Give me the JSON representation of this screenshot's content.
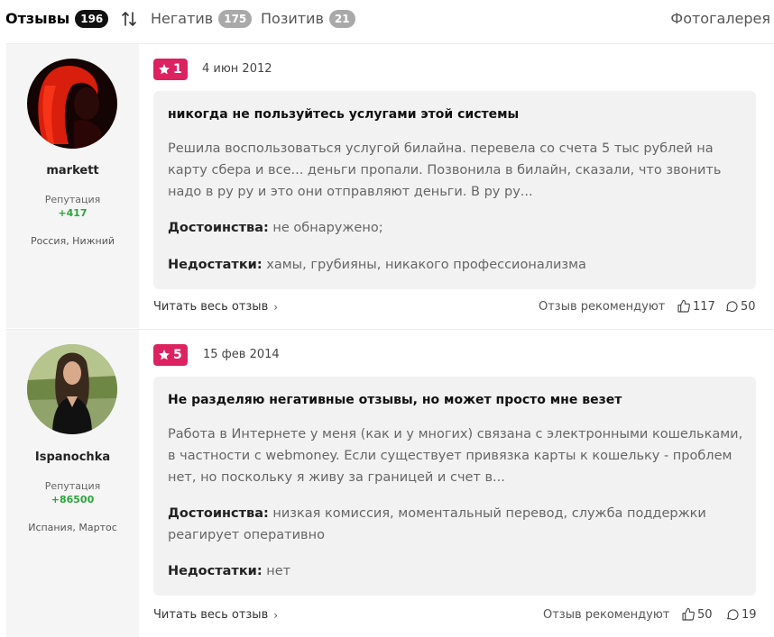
{
  "tabs": {
    "reviews": {
      "label": "Отзывы",
      "count": "196"
    },
    "negative": {
      "label": "Негатив",
      "count": "175"
    },
    "positive": {
      "label": "Позитив",
      "count": "21"
    },
    "gallery": {
      "label": "Фотогалерея"
    }
  },
  "reviews": [
    {
      "author": {
        "name": "markett",
        "reputation_label": "Репутация",
        "reputation": "+417",
        "location": "Россия, Нижний"
      },
      "rating": "1",
      "date": "4 июн 2012",
      "title": "никогда не пользуйтесь услугами этой системы",
      "text": "Решила воспользоваться услугой билайна. перевела со счета 5 тыс рублей на карту сбера и все... деньги пропали. Позвонила в билайн, сказали, что звонить надо в ру ру и это они отправляют деньги. В ру ру...",
      "pros_label": "Достоинства:",
      "pros": "не обнаружено;",
      "cons_label": "Недостатки:",
      "cons": "хамы, грубияны, никакого профессионализма",
      "read_more": "Читать весь отзыв",
      "recommend": "Отзыв рекомендуют",
      "likes": "117",
      "comments": "50"
    },
    {
      "author": {
        "name": "Ispanochka",
        "reputation_label": "Репутация",
        "reputation": "+86500",
        "location": "Испания, Мартос"
      },
      "rating": "5",
      "date": "15 фев 2014",
      "title": "Не разделяю негативные отзывы, но может просто мне везет",
      "text": "Работа в Интернете у меня (как и у многих) связана с электронными кошельками, в частности с webmoney. Если существует привязка карты к кошельку - проблем нет, но поскольку я живу за границей и счет в...",
      "pros_label": "Достоинства:",
      "pros": "низкая комиссия, моментальный перевод, служба поддержки реагирует оперативно",
      "cons_label": "Недостатки:",
      "cons": "нет",
      "read_more": "Читать весь отзыв",
      "recommend": "Отзыв рекомендуют",
      "likes": "50",
      "comments": "19"
    }
  ],
  "colors": {
    "rating_badge": "#dc2260",
    "reputation": "#2aa63d"
  }
}
